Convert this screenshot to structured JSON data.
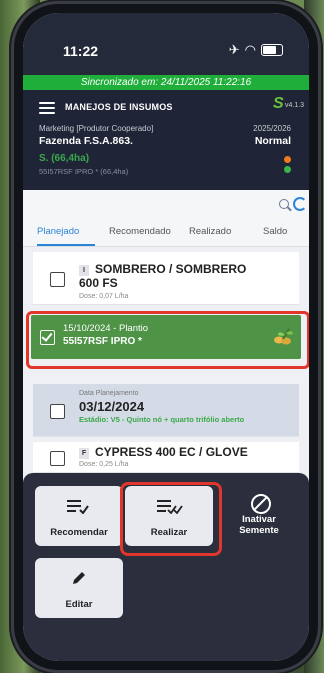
{
  "status": {
    "time": "11:22"
  },
  "sync": {
    "text": "Sincronizado em: 24/11/2025 11:22:16"
  },
  "appbar": {
    "title": "MANEJOS DE INSUMOS",
    "version": "v4.1.3",
    "producer_type": "Marketing [Produtor Cooperado]",
    "farm": "Fazenda F.S.A.863.",
    "season": "2025/2026",
    "mode": "Normal",
    "seed_summary": "S. (66,4ha)",
    "seed_variety": "55I57RSF IPRO * (66,4ha)"
  },
  "tabs": [
    {
      "label": "Planejado",
      "active": true
    },
    {
      "label": "Recomendado",
      "active": false
    },
    {
      "label": "Realizado",
      "active": false
    },
    {
      "label": "Saldo",
      "active": false
    }
  ],
  "cards": {
    "c1": {
      "badge": "I",
      "name_line1": "SOMBRERO / SOMBRERO",
      "name_line2": "600 FS",
      "dose": "Dose: 0,07 L/ha"
    },
    "c2": {
      "date": "15/10/2024 - Plantio",
      "seed": "55I57RSF IPRO *"
    },
    "c3": {
      "label": "Data Planejamento",
      "date": "03/12/2024",
      "stage": "Estádio: V5 - Quinto nó + quarto trifólio aberto"
    },
    "c4": {
      "badge": "F",
      "name": "CYPRESS 400 EC / GLOVE",
      "dose": "Dose: 0,25 L/ha"
    }
  },
  "actions": {
    "recomendar": "Recomendar",
    "realizar": "Realizar",
    "inativar_1": "Inativar",
    "inativar_2": "Semente",
    "editar": "Editar"
  },
  "colors": {
    "sync_bar": "#1fae3a",
    "selected_card": "#4e9346",
    "highlight": "#e0362c",
    "accent": "#2b84d8"
  }
}
